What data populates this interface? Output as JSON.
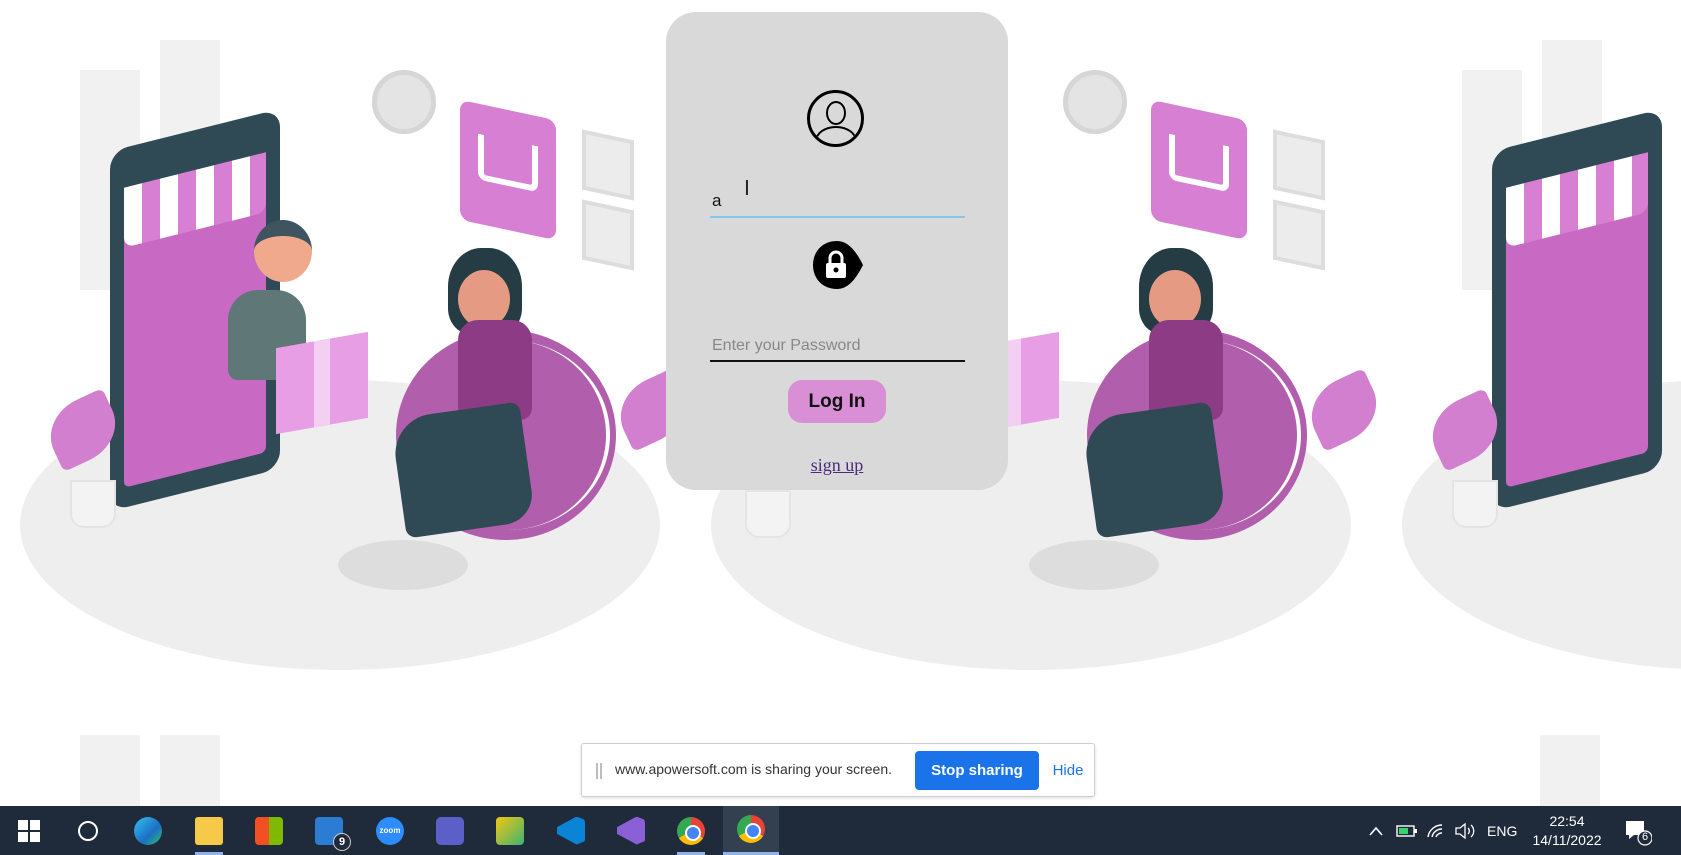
{
  "login": {
    "username_value": "a",
    "password_placeholder": "Enter your Password",
    "login_label": "Log In",
    "signup_label": "sign up"
  },
  "sharing_bar": {
    "message": "www.apowersoft.com is sharing your screen.",
    "stop_label": "Stop sharing",
    "hide_label": "Hide"
  },
  "taskbar": {
    "apps": [
      {
        "name": "start",
        "icon": "windows-icon"
      },
      {
        "name": "search",
        "icon": "cortana-icon"
      },
      {
        "name": "edge",
        "icon": "edge-icon"
      },
      {
        "name": "file-explorer",
        "icon": "folder-icon"
      },
      {
        "name": "store",
        "icon": "store-icon"
      },
      {
        "name": "mail",
        "icon": "mail-icon",
        "badge": "9"
      },
      {
        "name": "zoom",
        "icon": "zoom-icon",
        "label": "zoom"
      },
      {
        "name": "teams",
        "icon": "teams-icon"
      },
      {
        "name": "snipping",
        "icon": "snip-icon"
      },
      {
        "name": "vscode",
        "icon": "vscode-icon"
      },
      {
        "name": "visual-studio",
        "icon": "visual-studio-icon"
      },
      {
        "name": "chrome",
        "icon": "chrome-icon"
      },
      {
        "name": "chrome-active",
        "icon": "chrome-icon"
      }
    ],
    "language": "ENG",
    "time": "22:54",
    "date": "14/11/2022",
    "notification_count": "6"
  },
  "colors": {
    "card_bg": "#d9d9d9",
    "button_bg": "#d98fd6",
    "accent_purple": "#c86ac4",
    "taskbar_bg": "#1f2b3a",
    "share_button": "#1a73e8"
  }
}
